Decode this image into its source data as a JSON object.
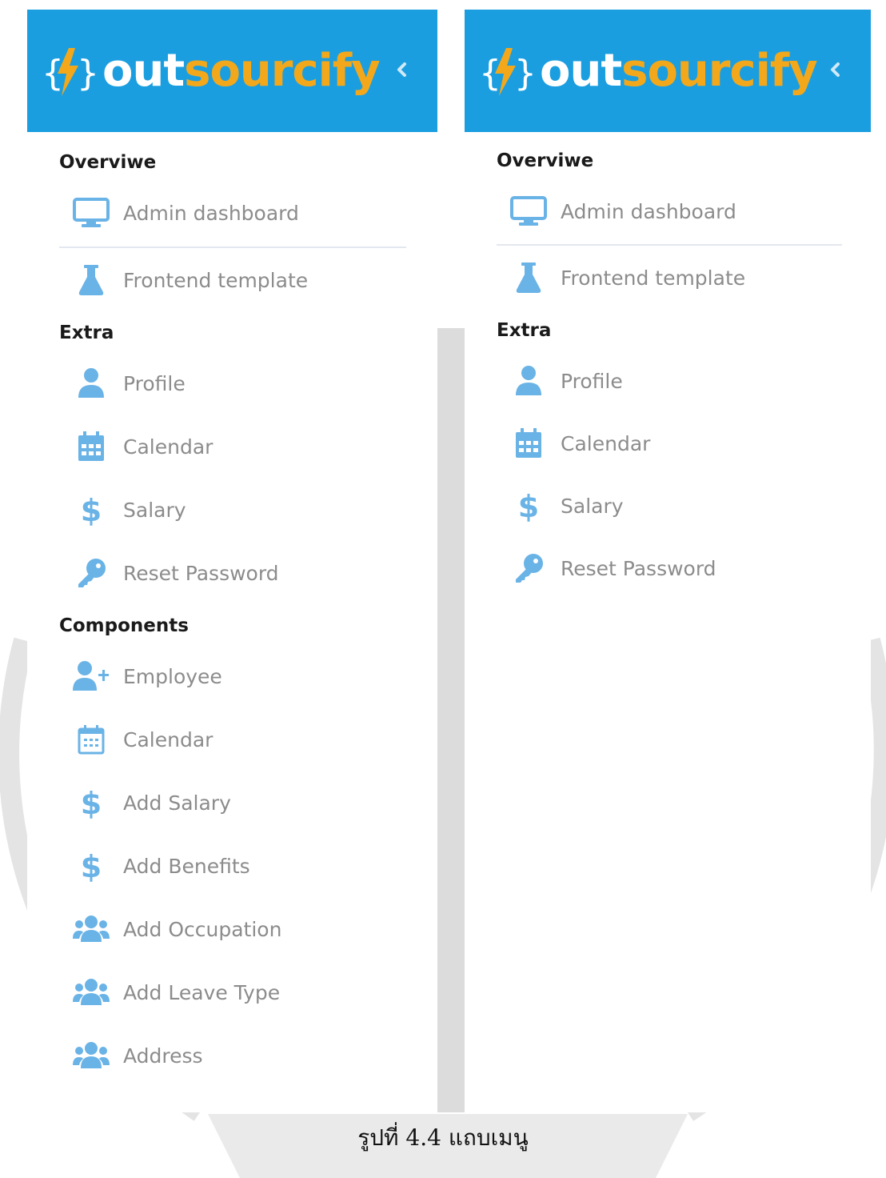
{
  "brand": {
    "name_part1": "out",
    "name_part2": "sourcify",
    "accent": "#f3a81b",
    "header_color": "#1b9ee0"
  },
  "left_panel": {
    "sections": {
      "overview": "Overviwe",
      "extra": "Extra",
      "components": "Components"
    },
    "items": {
      "admin_dashboard": "Admin dashboard",
      "frontend_template": "Frontend template",
      "profile": "Profile",
      "calendar": "Calendar",
      "salary": "Salary",
      "reset_password": "Reset Password",
      "employee": "Employee",
      "calendar2": "Calendar",
      "add_salary": "Add Salary",
      "add_benefits": "Add Benefits",
      "add_occupation": "Add Occupation",
      "add_leave_type": "Add Leave Type",
      "address": "Address"
    }
  },
  "right_panel": {
    "sections": {
      "overview": "Overviwe",
      "extra": "Extra"
    },
    "items": {
      "admin_dashboard": "Admin dashboard",
      "frontend_template": "Frontend template",
      "profile": "Profile",
      "calendar": "Calendar",
      "salary": "Salary",
      "reset_password": "Reset Password"
    }
  },
  "icons": {
    "monitor": "monitor-icon",
    "flask": "flask-icon",
    "user": "user-icon",
    "calendar": "calendar-icon",
    "dollar": "dollar-icon",
    "key": "key-icon",
    "user_plus": "user-plus-icon",
    "users": "users-icon",
    "chevron": "chevron-left-icon"
  },
  "icon_color": "#6ab3e6",
  "caption": "รูปที่ 4.4 แถบเมนู"
}
